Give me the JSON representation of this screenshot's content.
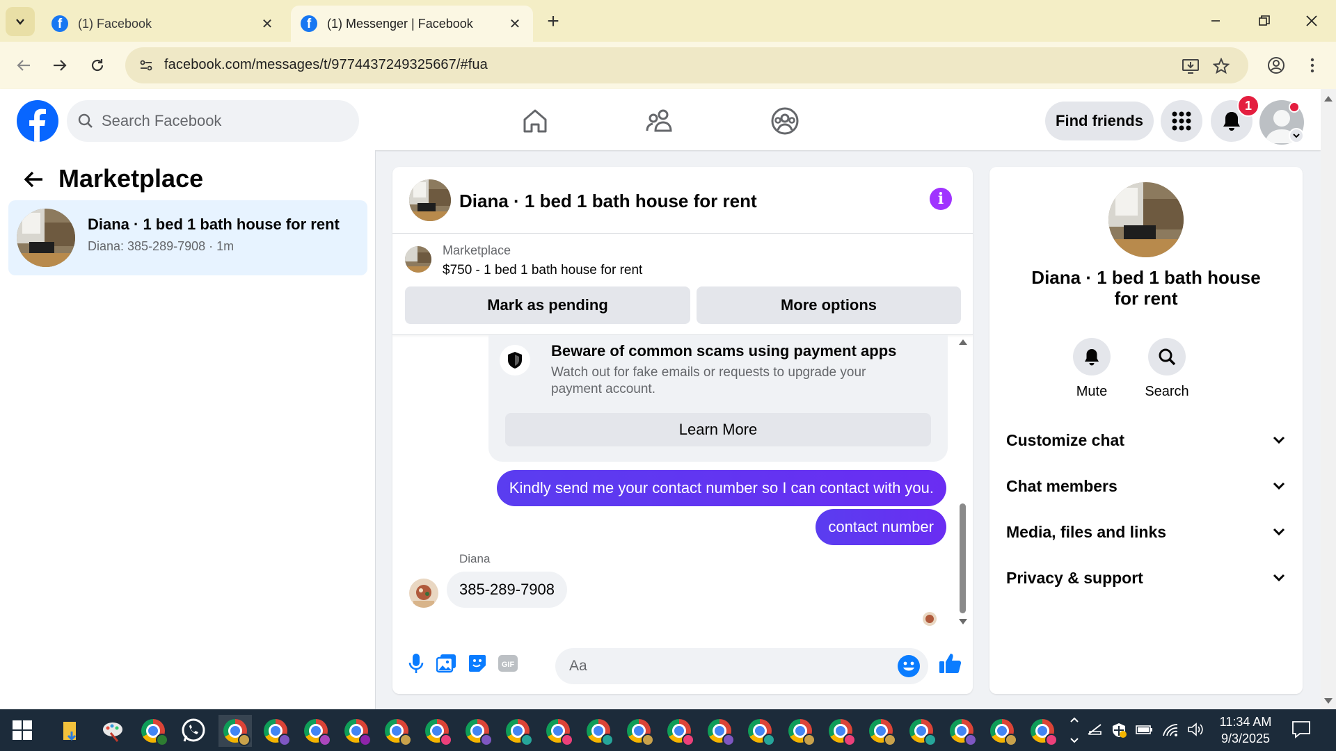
{
  "browser": {
    "tabs": [
      {
        "title": "(1) Facebook",
        "active": false
      },
      {
        "title": "(1) Messenger | Facebook",
        "active": true
      }
    ],
    "url": "facebook.com/messages/t/9774437249325667/#fua"
  },
  "header": {
    "search_placeholder": "Search Facebook",
    "find_friends": "Find friends",
    "notification_count": "1"
  },
  "left": {
    "title": "Marketplace",
    "conversation": {
      "name": "Diana · 1 bed 1 bath house for rent",
      "preview": "Diana: 385-289-7908 · 1m"
    }
  },
  "chat": {
    "title": "Diana · 1 bed 1 bath house for rent",
    "listing": {
      "label": "Marketplace",
      "price_title": "$750 - 1 bed 1 bath house for rent",
      "mark_pending": "Mark as pending",
      "more_options": "More options"
    },
    "scam_notice": {
      "title": "Beware of common scams using payment apps",
      "body": "Watch out for fake emails or requests to upgrade your payment account.",
      "button": "Learn More"
    },
    "messages": [
      {
        "from": "me",
        "text": "Kindly send me your contact number so I can contact with you."
      },
      {
        "from": "me",
        "text": "contact number"
      },
      {
        "from": "Diana",
        "text": "385-289-7908"
      }
    ],
    "sender_name": "Diana",
    "input_placeholder": "Aa"
  },
  "info": {
    "name": "Diana · 1 bed 1 bath house for rent",
    "actions": [
      {
        "label": "Mute",
        "icon": "bell-icon"
      },
      {
        "label": "Search",
        "icon": "search-icon"
      }
    ],
    "sections": [
      "Customize chat",
      "Chat members",
      "Media, files and links",
      "Privacy & support"
    ]
  },
  "taskbar": {
    "time": "11:34 AM",
    "date": "9/3/2025"
  },
  "colors": {
    "fb_blue": "#0866ff",
    "messenger_purple": "#5b3ef2",
    "selected_bg": "#e7f3ff"
  }
}
